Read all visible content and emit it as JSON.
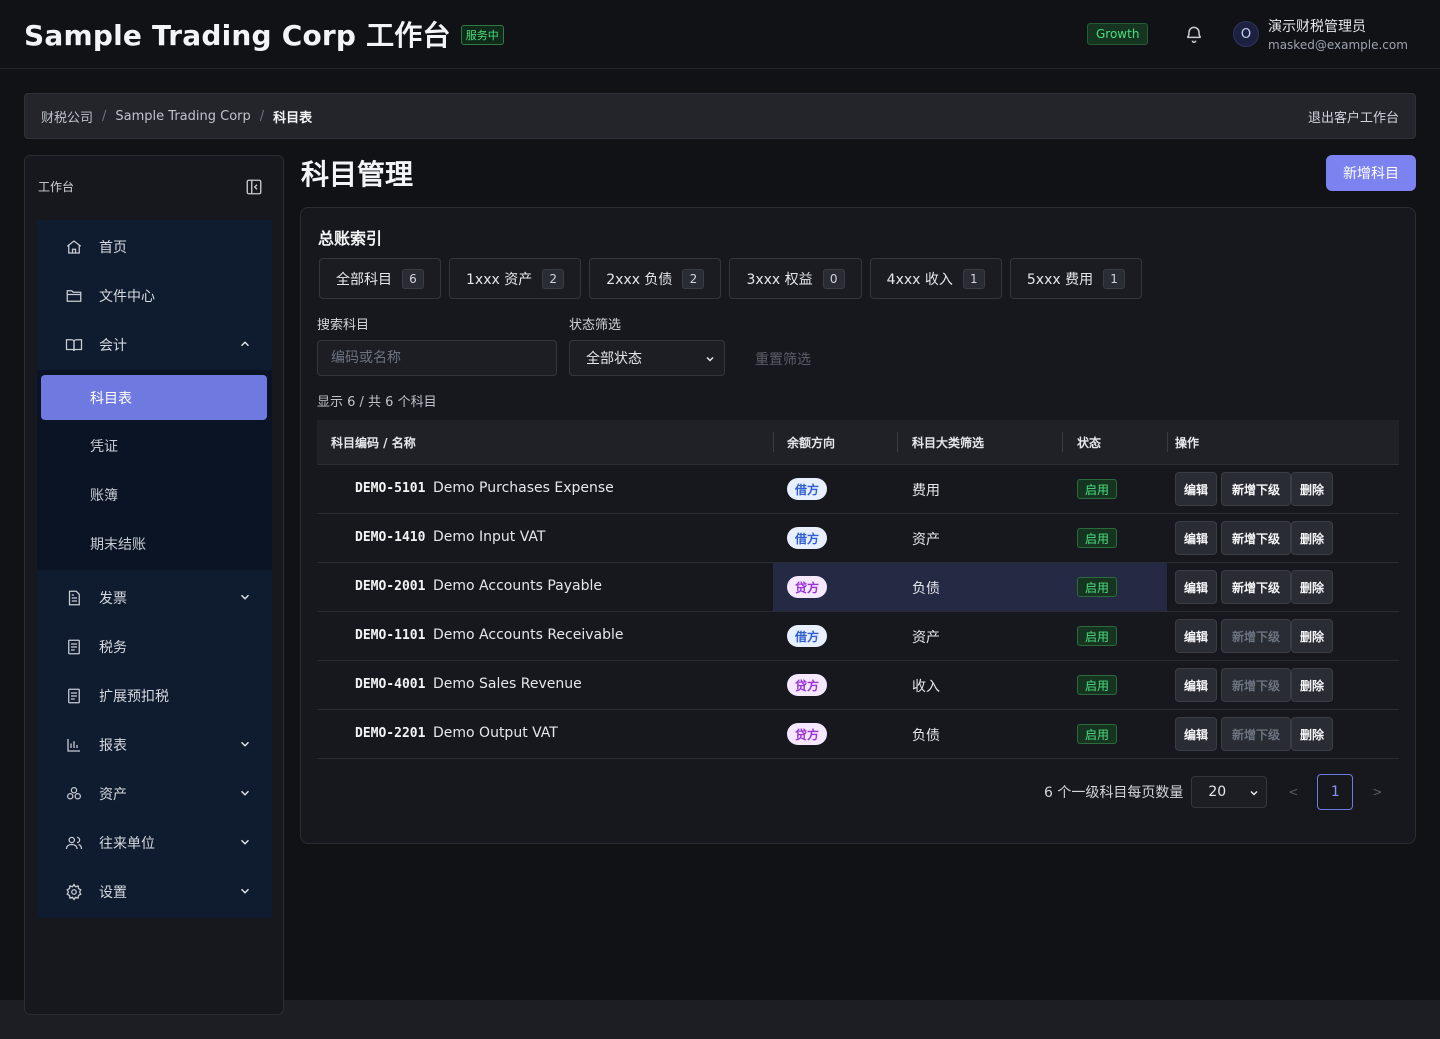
{
  "header": {
    "title": "Sample Trading Corp 工作台",
    "service_badge": "服务中",
    "plan": "Growth",
    "user_initial": "O",
    "user_name": "演示财税管理员",
    "user_email": "masked@example.com"
  },
  "breadcrumb": {
    "items": [
      "财税公司",
      "Sample Trading Corp",
      "科目表"
    ],
    "separator": "/",
    "exit": "退出客户工作台"
  },
  "sidebar": {
    "title": "工作台",
    "items": [
      {
        "label": "首页",
        "icon": "home-icon"
      },
      {
        "label": "文件中心",
        "icon": "folder-icon"
      },
      {
        "label": "会计",
        "icon": "book-icon",
        "expanded": true
      },
      {
        "label": "发票",
        "icon": "document-icon"
      },
      {
        "label": "税务",
        "icon": "receipt-icon"
      },
      {
        "label": "扩展预扣税",
        "icon": "receipt-icon"
      },
      {
        "label": "报表",
        "icon": "bar-chart-icon"
      },
      {
        "label": "资产",
        "icon": "asset-icon"
      },
      {
        "label": "往来单位",
        "icon": "users-icon"
      },
      {
        "label": "设置",
        "icon": "gear-icon"
      }
    ],
    "accounting_sub": [
      {
        "label": "科目表",
        "active": true
      },
      {
        "label": "凭证"
      },
      {
        "label": "账簿"
      },
      {
        "label": "期末结账"
      }
    ]
  },
  "main": {
    "title": "科目管理",
    "add_button": "新增科目",
    "index_title": "总账索引",
    "chips": [
      {
        "label": "全部科目",
        "count": "6"
      },
      {
        "label": "1xxx 资产",
        "count": "2"
      },
      {
        "label": "2xxx 负债",
        "count": "2"
      },
      {
        "label": "3xxx 权益",
        "count": "0"
      },
      {
        "label": "4xxx 收入",
        "count": "1"
      },
      {
        "label": "5xxx 费用",
        "count": "1"
      }
    ],
    "search_label": "搜索科目",
    "search_placeholder": "编码或名称",
    "status_label": "状态筛选",
    "status_value": "全部状态",
    "reset": "重置筛选",
    "count_text": "显示 6 / 共 6 个科目"
  },
  "table": {
    "columns": [
      "科目编码 / 名称",
      "余额方向",
      "科目大类筛选",
      "状态",
      "操作"
    ],
    "actions": {
      "edit": "编辑",
      "add_child": "新增下级",
      "delete": "删除"
    },
    "rows": [
      {
        "code": "DEMO-5101",
        "name": "Demo Purchases Expense",
        "direction": "借方",
        "category": "费用",
        "status": "启用",
        "child_enabled": true
      },
      {
        "code": "DEMO-1410",
        "name": "Demo Input VAT",
        "direction": "借方",
        "category": "资产",
        "status": "启用",
        "child_enabled": true
      },
      {
        "code": "DEMO-2001",
        "name": "Demo Accounts Payable",
        "direction": "贷方",
        "category": "负债",
        "status": "启用",
        "child_enabled": true
      },
      {
        "code": "DEMO-1101",
        "name": "Demo Accounts Receivable",
        "direction": "借方",
        "category": "资产",
        "status": "启用",
        "child_enabled": false
      },
      {
        "code": "DEMO-4001",
        "name": "Demo Sales Revenue",
        "direction": "贷方",
        "category": "收入",
        "status": "启用",
        "child_enabled": false
      },
      {
        "code": "DEMO-2201",
        "name": "Demo Output VAT",
        "direction": "贷方",
        "category": "负债",
        "status": "启用",
        "child_enabled": false
      }
    ]
  },
  "pagination": {
    "summary": "6 个一级科目每页数量",
    "page_size": "20",
    "prev": "<",
    "current": "1",
    "next": ">"
  },
  "colors": {
    "accent": "#7c83f0",
    "success": "#4ade80",
    "background": "#111216"
  }
}
